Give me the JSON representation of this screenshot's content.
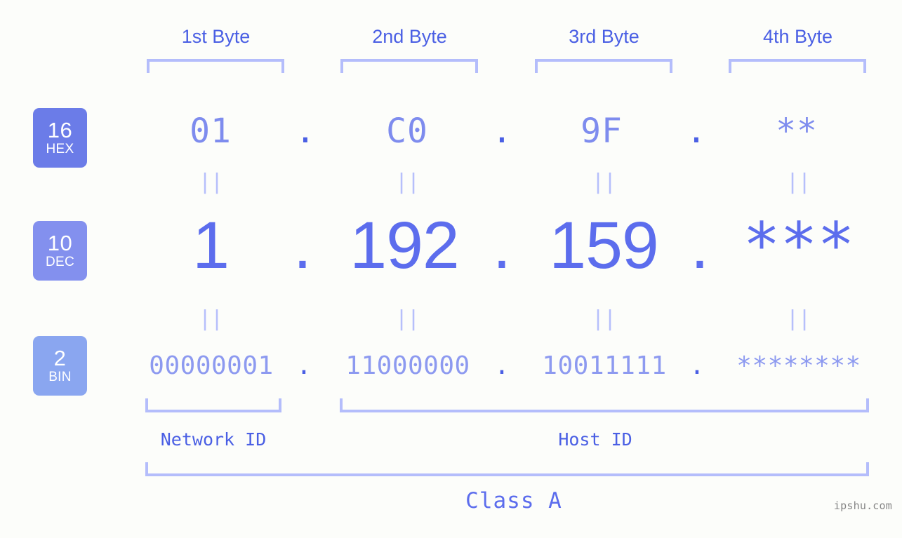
{
  "ip": {
    "bytes": [
      {
        "header": "1st Byte",
        "hex": "01",
        "dec": "1",
        "bin": "00000001"
      },
      {
        "header": "2nd Byte",
        "hex": "C0",
        "dec": "192",
        "bin": "11000000"
      },
      {
        "header": "3rd Byte",
        "hex": "9F",
        "dec": "159",
        "bin": "10011111"
      },
      {
        "header": "4th Byte",
        "hex": "**",
        "dec": "***",
        "bin": "********"
      }
    ],
    "separator": ".",
    "equals_mark": "||"
  },
  "bases": [
    {
      "number": "16",
      "name": "HEX",
      "color": "#6b7ce8"
    },
    {
      "number": "10",
      "name": "DEC",
      "color": "#8390ee"
    },
    {
      "number": "2",
      "name": "BIN",
      "color": "#8aa6f0"
    }
  ],
  "segments": {
    "network_id": "Network ID",
    "host_id": "Host ID"
  },
  "class_label": "Class A",
  "watermark": "ipshu.com",
  "colors": {
    "background": "#fcfdfa",
    "accent": "#5c6ded",
    "header_text": "#4a5fe4",
    "bracket": "#b4bdfb",
    "hex_text": "#7e8cee",
    "bin_text": "#8d9af0",
    "equals": "#b6bffb",
    "watermark": "#868686"
  }
}
